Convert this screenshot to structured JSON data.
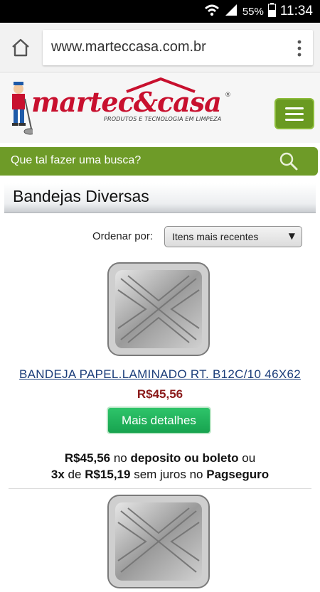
{
  "status_bar": {
    "battery_percent": "55%",
    "time": "11:34",
    "icons": [
      "wifi-icon",
      "signal-icon",
      "battery-icon"
    ]
  },
  "browser": {
    "url": "www.marteccasa.com.br",
    "icons": [
      "home-icon",
      "overflow-menu-icon"
    ]
  },
  "header": {
    "logo_text": "martec&casa",
    "logo_tagline": "PRODUTOS E TECNOLOGIA EM LIMPEZA",
    "logo_registered": "®",
    "menu_icon": "hamburger-icon"
  },
  "search": {
    "placeholder": "Que tal fazer uma busca?",
    "icon": "search-icon"
  },
  "category": {
    "title": "Bandejas Diversas"
  },
  "sort": {
    "label": "Ordenar por:",
    "selected": "Itens mais recentes"
  },
  "products": [
    {
      "title": "BANDEJA PAPEL.LAMINADO RT. B12C/10 46X62",
      "price": "R$45,56",
      "details_label": "Mais detalhes",
      "payment": {
        "price": "R$45,56",
        "text1": " no ",
        "method1": "deposito ou boleto",
        "text2": " ou",
        "installments": "3x",
        "text3": " de ",
        "installment_value": "R$15,19",
        "text4": " sem juros no ",
        "method2": "Pagseguro"
      }
    }
  ],
  "colors": {
    "brand_green": "#6e9b28",
    "brand_red": "#c8102e",
    "price_red": "#8b1a1a",
    "cta_green": "#17a34f",
    "link_blue": "#1b3d7a"
  }
}
